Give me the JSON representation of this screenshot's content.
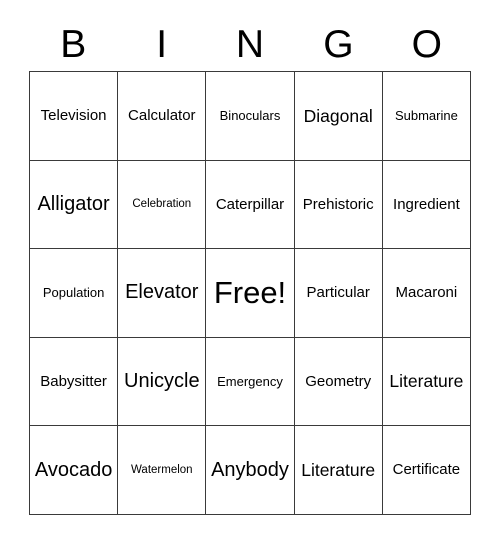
{
  "header": {
    "letters": [
      "B",
      "I",
      "N",
      "G",
      "O"
    ]
  },
  "grid": {
    "rows": 5,
    "columns": 5,
    "border_color": "#3a3a3a",
    "background_color": "#ffffff",
    "text_color": "#000000",
    "cells": [
      [
        {
          "label": "Television",
          "size": "md"
        },
        {
          "label": "Calculator",
          "size": "md"
        },
        {
          "label": "Binoculars",
          "size": "sm"
        },
        {
          "label": "Diagonal",
          "size": "lg"
        },
        {
          "label": "Submarine",
          "size": "sm"
        }
      ],
      [
        {
          "label": "Alligator",
          "size": "xl"
        },
        {
          "label": "Celebration",
          "size": "xs"
        },
        {
          "label": "Caterpillar",
          "size": "md"
        },
        {
          "label": "Prehistoric",
          "size": "md"
        },
        {
          "label": "Ingredient",
          "size": "md"
        }
      ],
      [
        {
          "label": "Population",
          "size": "sm"
        },
        {
          "label": "Elevator",
          "size": "xl"
        },
        {
          "label": "Free!",
          "size": "free"
        },
        {
          "label": "Particular",
          "size": "md"
        },
        {
          "label": "Macaroni",
          "size": "md"
        }
      ],
      [
        {
          "label": "Babysitter",
          "size": "md"
        },
        {
          "label": "Unicycle",
          "size": "xl"
        },
        {
          "label": "Emergency",
          "size": "sm"
        },
        {
          "label": "Geometry",
          "size": "md"
        },
        {
          "label": "Literature",
          "size": "lg"
        }
      ],
      [
        {
          "label": "Avocado",
          "size": "xl"
        },
        {
          "label": "Watermelon",
          "size": "xs"
        },
        {
          "label": "Anybody",
          "size": "xl"
        },
        {
          "label": "Literature",
          "size": "lg"
        },
        {
          "label": "Certificate",
          "size": "md"
        }
      ]
    ]
  }
}
